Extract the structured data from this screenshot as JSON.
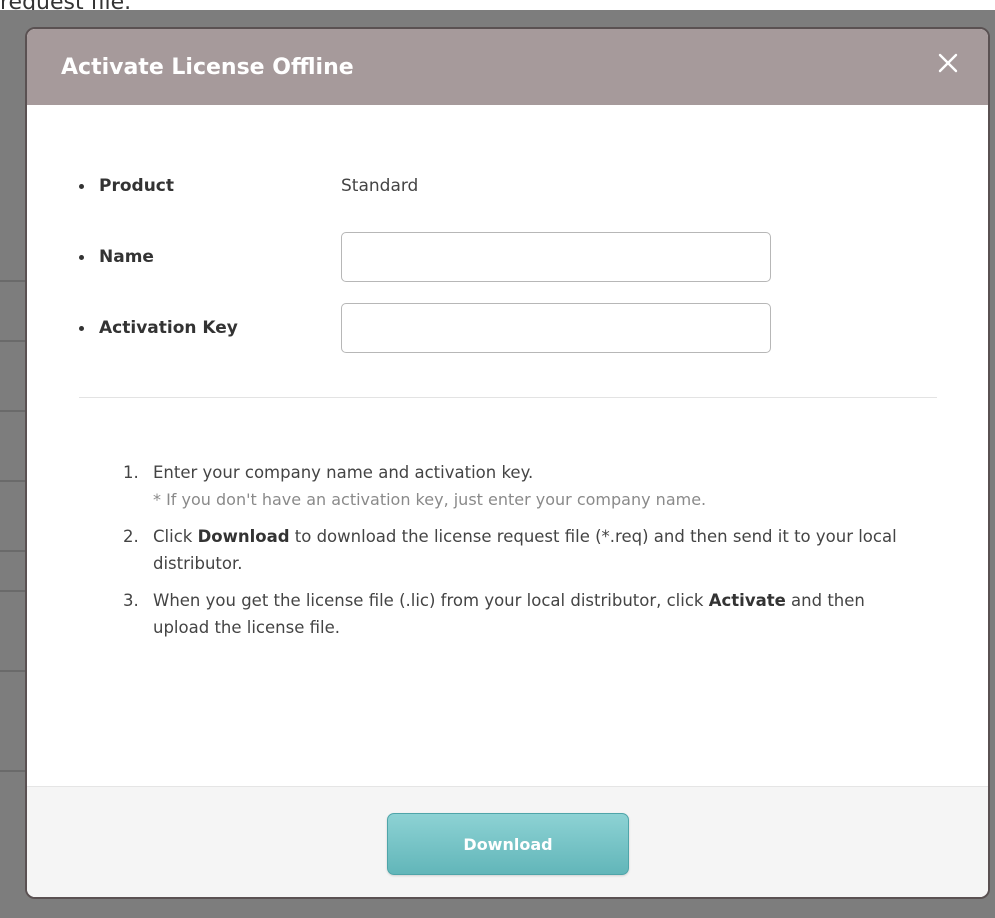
{
  "page": {
    "top_snippet": "request file."
  },
  "dialog": {
    "title": "Activate License Offline",
    "close_label": "×",
    "fields": [
      {
        "label": "Product",
        "value": "Standard"
      },
      {
        "label": "Name",
        "value": "",
        "placeholder": ""
      },
      {
        "label": "Activation Key",
        "value": "",
        "placeholder": ""
      }
    ],
    "instructions": [
      {
        "num": "1.",
        "text": "Enter your company name and activation key.",
        "note": "* If you don't have an activation key, just enter your company name."
      },
      {
        "num": "2.",
        "pre": "Click ",
        "bold": "Download",
        "post": " to download the license request file (*.req) and then send it to your local distributor."
      },
      {
        "num": "3.",
        "pre": "When you get the license file (.lic) from your local distributor, click ",
        "bold": "Activate",
        "post": " and then upload the license file."
      }
    ],
    "download_label": "Download"
  },
  "colors": {
    "header": "#a69a9b",
    "button": "#6fbfc1",
    "backdrop": "#7d7d7d"
  }
}
